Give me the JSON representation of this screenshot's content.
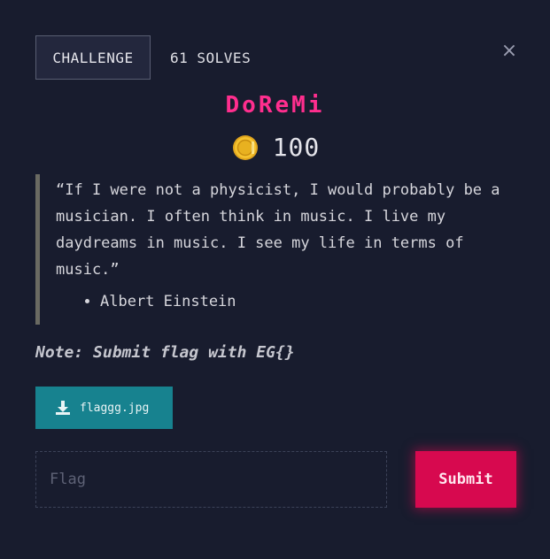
{
  "tabs": {
    "challenge_label": "CHALLENGE",
    "solves_label": "61 SOLVES"
  },
  "close_symbol": "×",
  "challenge": {
    "title": "DoReMi",
    "points": "100",
    "quote": "“If I were not a physicist, I would probably be a musician. I often think in music. I live my daydreams in music. I see my life in terms of music.”",
    "author": "Albert Einstein",
    "note": "Note: Submit flag with EG{}"
  },
  "file": {
    "name": "flaggg.jpg",
    "icon": "download-icon"
  },
  "flag_input": {
    "placeholder": "Flag",
    "value": ""
  },
  "submit_label": "Submit",
  "colors": {
    "background": "#181c2e",
    "title": "#ff2e8e",
    "download_button": "#17828f",
    "submit_button": "#d7094f",
    "coin": "#f5c22e"
  }
}
